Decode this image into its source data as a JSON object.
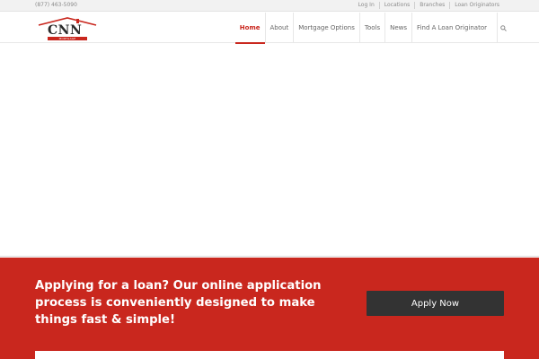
{
  "topbar": {
    "phone": "(877) 463-5090",
    "links": [
      "Log In",
      "Locations",
      "Branches",
      "Loan Originators"
    ]
  },
  "logo": {
    "brand": "CNN",
    "tagline": "MORTGAGE",
    "accent": "#c9271e"
  },
  "nav": {
    "items": [
      "Home",
      "About",
      "Mortgage Options",
      "Tools",
      "News",
      "Find A Loan Originator"
    ],
    "active": "Home",
    "search_icon": "search-icon"
  },
  "cta": {
    "text": "Applying for a loan? Our online application process is conveniently designed to make things fast & simple!",
    "button_label": "Apply Now",
    "background": "#c9271e",
    "button_color": "#333333"
  }
}
